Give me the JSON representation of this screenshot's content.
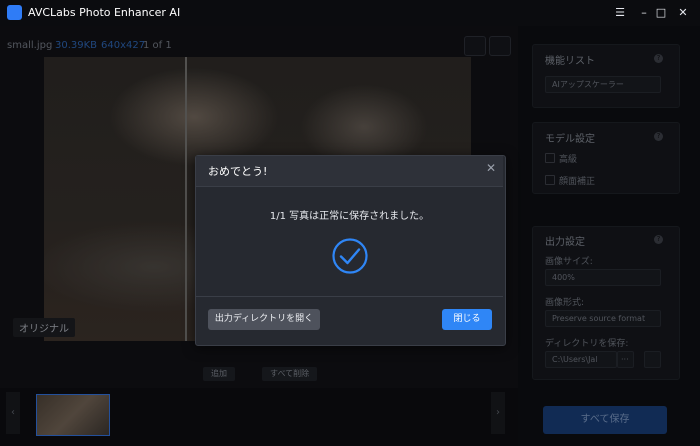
{
  "titlebar": {
    "app_title": "AVCLabs Photo Enhancer AI",
    "menu_icon": "hamburger-icon",
    "minimize_icon": "minimize-icon",
    "maximize_icon": "maximize-icon",
    "close_icon": "close-icon"
  },
  "fileinfo": {
    "filename": "small.jpg",
    "filesize": "30.39KB",
    "resolution": "640x427",
    "count": "1 of 1"
  },
  "preview": {
    "original_label": "オリジナル"
  },
  "toolbar": {
    "add_label": "追加",
    "remove_all_label": "すべて削除"
  },
  "panel": {
    "features": {
      "title": "機能リスト",
      "selected": "AIアップスケーラー"
    },
    "model": {
      "title": "モデル設定",
      "options": [
        "高級",
        "顔面補正"
      ]
    },
    "output": {
      "title": "出力設定",
      "size_label": "画像サイズ:",
      "size_value": "400%",
      "format_label": "画像形式:",
      "format_value": "Preserve source format",
      "dir_label": "ディレクトリを保存:",
      "dir_value": "C:\\Users\\Jal",
      "dir_more": "···"
    },
    "save_all_label": "すべて保存"
  },
  "dialog": {
    "title": "おめでとう!",
    "message": "1/1 写真は正常に保存されました。",
    "open_dir_label": "出力ディレクトリを開く",
    "close_label": "閉じる",
    "accent": "#2f86f6"
  }
}
